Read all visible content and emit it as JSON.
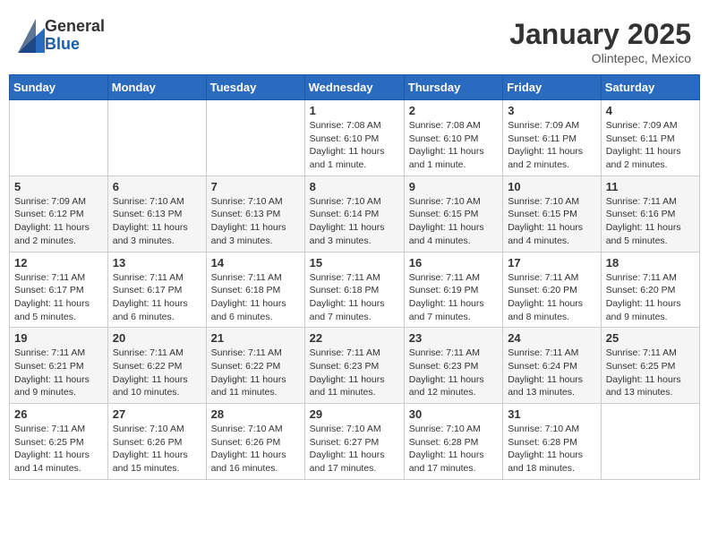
{
  "header": {
    "logo_general": "General",
    "logo_blue": "Blue",
    "month_title": "January 2025",
    "location": "Olintepec, Mexico"
  },
  "weekdays": [
    "Sunday",
    "Monday",
    "Tuesday",
    "Wednesday",
    "Thursday",
    "Friday",
    "Saturday"
  ],
  "weeks": [
    [
      {
        "day": "",
        "info": ""
      },
      {
        "day": "",
        "info": ""
      },
      {
        "day": "",
        "info": ""
      },
      {
        "day": "1",
        "info": "Sunrise: 7:08 AM\nSunset: 6:10 PM\nDaylight: 11 hours\nand 1 minute."
      },
      {
        "day": "2",
        "info": "Sunrise: 7:08 AM\nSunset: 6:10 PM\nDaylight: 11 hours\nand 1 minute."
      },
      {
        "day": "3",
        "info": "Sunrise: 7:09 AM\nSunset: 6:11 PM\nDaylight: 11 hours\nand 2 minutes."
      },
      {
        "day": "4",
        "info": "Sunrise: 7:09 AM\nSunset: 6:11 PM\nDaylight: 11 hours\nand 2 minutes."
      }
    ],
    [
      {
        "day": "5",
        "info": "Sunrise: 7:09 AM\nSunset: 6:12 PM\nDaylight: 11 hours\nand 2 minutes."
      },
      {
        "day": "6",
        "info": "Sunrise: 7:10 AM\nSunset: 6:13 PM\nDaylight: 11 hours\nand 3 minutes."
      },
      {
        "day": "7",
        "info": "Sunrise: 7:10 AM\nSunset: 6:13 PM\nDaylight: 11 hours\nand 3 minutes."
      },
      {
        "day": "8",
        "info": "Sunrise: 7:10 AM\nSunset: 6:14 PM\nDaylight: 11 hours\nand 3 minutes."
      },
      {
        "day": "9",
        "info": "Sunrise: 7:10 AM\nSunset: 6:15 PM\nDaylight: 11 hours\nand 4 minutes."
      },
      {
        "day": "10",
        "info": "Sunrise: 7:10 AM\nSunset: 6:15 PM\nDaylight: 11 hours\nand 4 minutes."
      },
      {
        "day": "11",
        "info": "Sunrise: 7:11 AM\nSunset: 6:16 PM\nDaylight: 11 hours\nand 5 minutes."
      }
    ],
    [
      {
        "day": "12",
        "info": "Sunrise: 7:11 AM\nSunset: 6:17 PM\nDaylight: 11 hours\nand 5 minutes."
      },
      {
        "day": "13",
        "info": "Sunrise: 7:11 AM\nSunset: 6:17 PM\nDaylight: 11 hours\nand 6 minutes."
      },
      {
        "day": "14",
        "info": "Sunrise: 7:11 AM\nSunset: 6:18 PM\nDaylight: 11 hours\nand 6 minutes."
      },
      {
        "day": "15",
        "info": "Sunrise: 7:11 AM\nSunset: 6:18 PM\nDaylight: 11 hours\nand 7 minutes."
      },
      {
        "day": "16",
        "info": "Sunrise: 7:11 AM\nSunset: 6:19 PM\nDaylight: 11 hours\nand 7 minutes."
      },
      {
        "day": "17",
        "info": "Sunrise: 7:11 AM\nSunset: 6:20 PM\nDaylight: 11 hours\nand 8 minutes."
      },
      {
        "day": "18",
        "info": "Sunrise: 7:11 AM\nSunset: 6:20 PM\nDaylight: 11 hours\nand 9 minutes."
      }
    ],
    [
      {
        "day": "19",
        "info": "Sunrise: 7:11 AM\nSunset: 6:21 PM\nDaylight: 11 hours\nand 9 minutes."
      },
      {
        "day": "20",
        "info": "Sunrise: 7:11 AM\nSunset: 6:22 PM\nDaylight: 11 hours\nand 10 minutes."
      },
      {
        "day": "21",
        "info": "Sunrise: 7:11 AM\nSunset: 6:22 PM\nDaylight: 11 hours\nand 11 minutes."
      },
      {
        "day": "22",
        "info": "Sunrise: 7:11 AM\nSunset: 6:23 PM\nDaylight: 11 hours\nand 11 minutes."
      },
      {
        "day": "23",
        "info": "Sunrise: 7:11 AM\nSunset: 6:23 PM\nDaylight: 11 hours\nand 12 minutes."
      },
      {
        "day": "24",
        "info": "Sunrise: 7:11 AM\nSunset: 6:24 PM\nDaylight: 11 hours\nand 13 minutes."
      },
      {
        "day": "25",
        "info": "Sunrise: 7:11 AM\nSunset: 6:25 PM\nDaylight: 11 hours\nand 13 minutes."
      }
    ],
    [
      {
        "day": "26",
        "info": "Sunrise: 7:11 AM\nSunset: 6:25 PM\nDaylight: 11 hours\nand 14 minutes."
      },
      {
        "day": "27",
        "info": "Sunrise: 7:10 AM\nSunset: 6:26 PM\nDaylight: 11 hours\nand 15 minutes."
      },
      {
        "day": "28",
        "info": "Sunrise: 7:10 AM\nSunset: 6:26 PM\nDaylight: 11 hours\nand 16 minutes."
      },
      {
        "day": "29",
        "info": "Sunrise: 7:10 AM\nSunset: 6:27 PM\nDaylight: 11 hours\nand 17 minutes."
      },
      {
        "day": "30",
        "info": "Sunrise: 7:10 AM\nSunset: 6:28 PM\nDaylight: 11 hours\nand 17 minutes."
      },
      {
        "day": "31",
        "info": "Sunrise: 7:10 AM\nSunset: 6:28 PM\nDaylight: 11 hours\nand 18 minutes."
      },
      {
        "day": "",
        "info": ""
      }
    ]
  ]
}
